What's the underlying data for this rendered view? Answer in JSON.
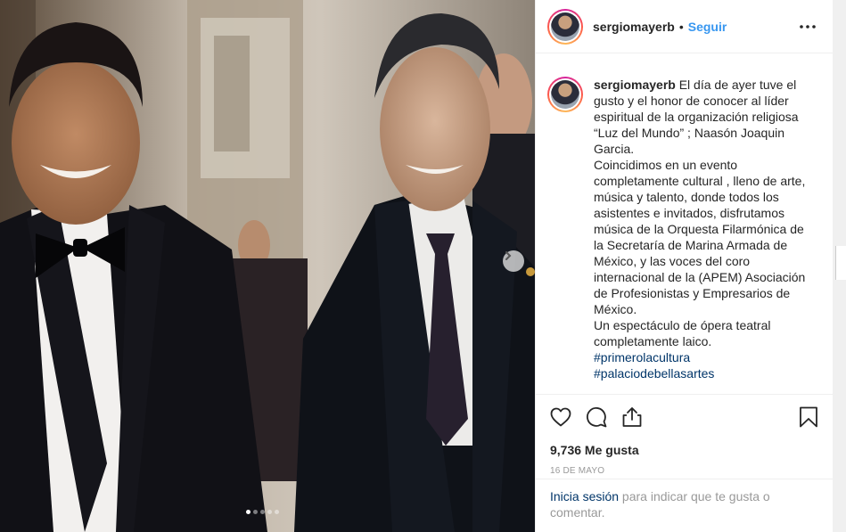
{
  "post": {
    "username": "sergiomayerb",
    "separator": "•",
    "follow_label": "Seguir",
    "more_icon": "more-horizontal-icon"
  },
  "caption": {
    "username": "sergiomayerb",
    "lines": [
      " El día de ayer tuve el",
      "gusto y el honor de conocer al líder",
      "espiritual de la organización religiosa",
      "“Luz del Mundo” ; Naasón Joaquin",
      "Garcia.",
      "Coincidimos en un evento",
      "completamente cultural , lleno de arte,",
      "música y talento, donde todos los",
      "asistentes e invitados, disfrutamos",
      "música de la Orquesta Filarmónica de",
      "la Secretaría de Marina Armada de",
      "México, y las voces del coro",
      "internacional de la (APEM) Asociación",
      "de Profesionistas y Empresarios de",
      "México.",
      "Un espectáculo de ópera teatral",
      "completamente laico."
    ],
    "hashtags": [
      "#primerolacultura",
      "#palaciodebellasartes"
    ]
  },
  "actions": {
    "like_icon": "heart-icon",
    "comment_icon": "comment-icon",
    "share_icon": "share-icon",
    "save_icon": "bookmark-icon"
  },
  "likes_text": "9,736 Me gusta",
  "date_text": "16 DE MAYO",
  "login": {
    "link": "Inicia sesión",
    "rest_line1": " para indicar que te gusta o",
    "rest_line2": "comentar."
  },
  "carousel": {
    "slide_count": 5,
    "active_index": 0
  },
  "colors": {
    "link_blue": "#3897f0",
    "hashtag_blue": "#003569",
    "text": "#262626",
    "muted": "#999999"
  }
}
